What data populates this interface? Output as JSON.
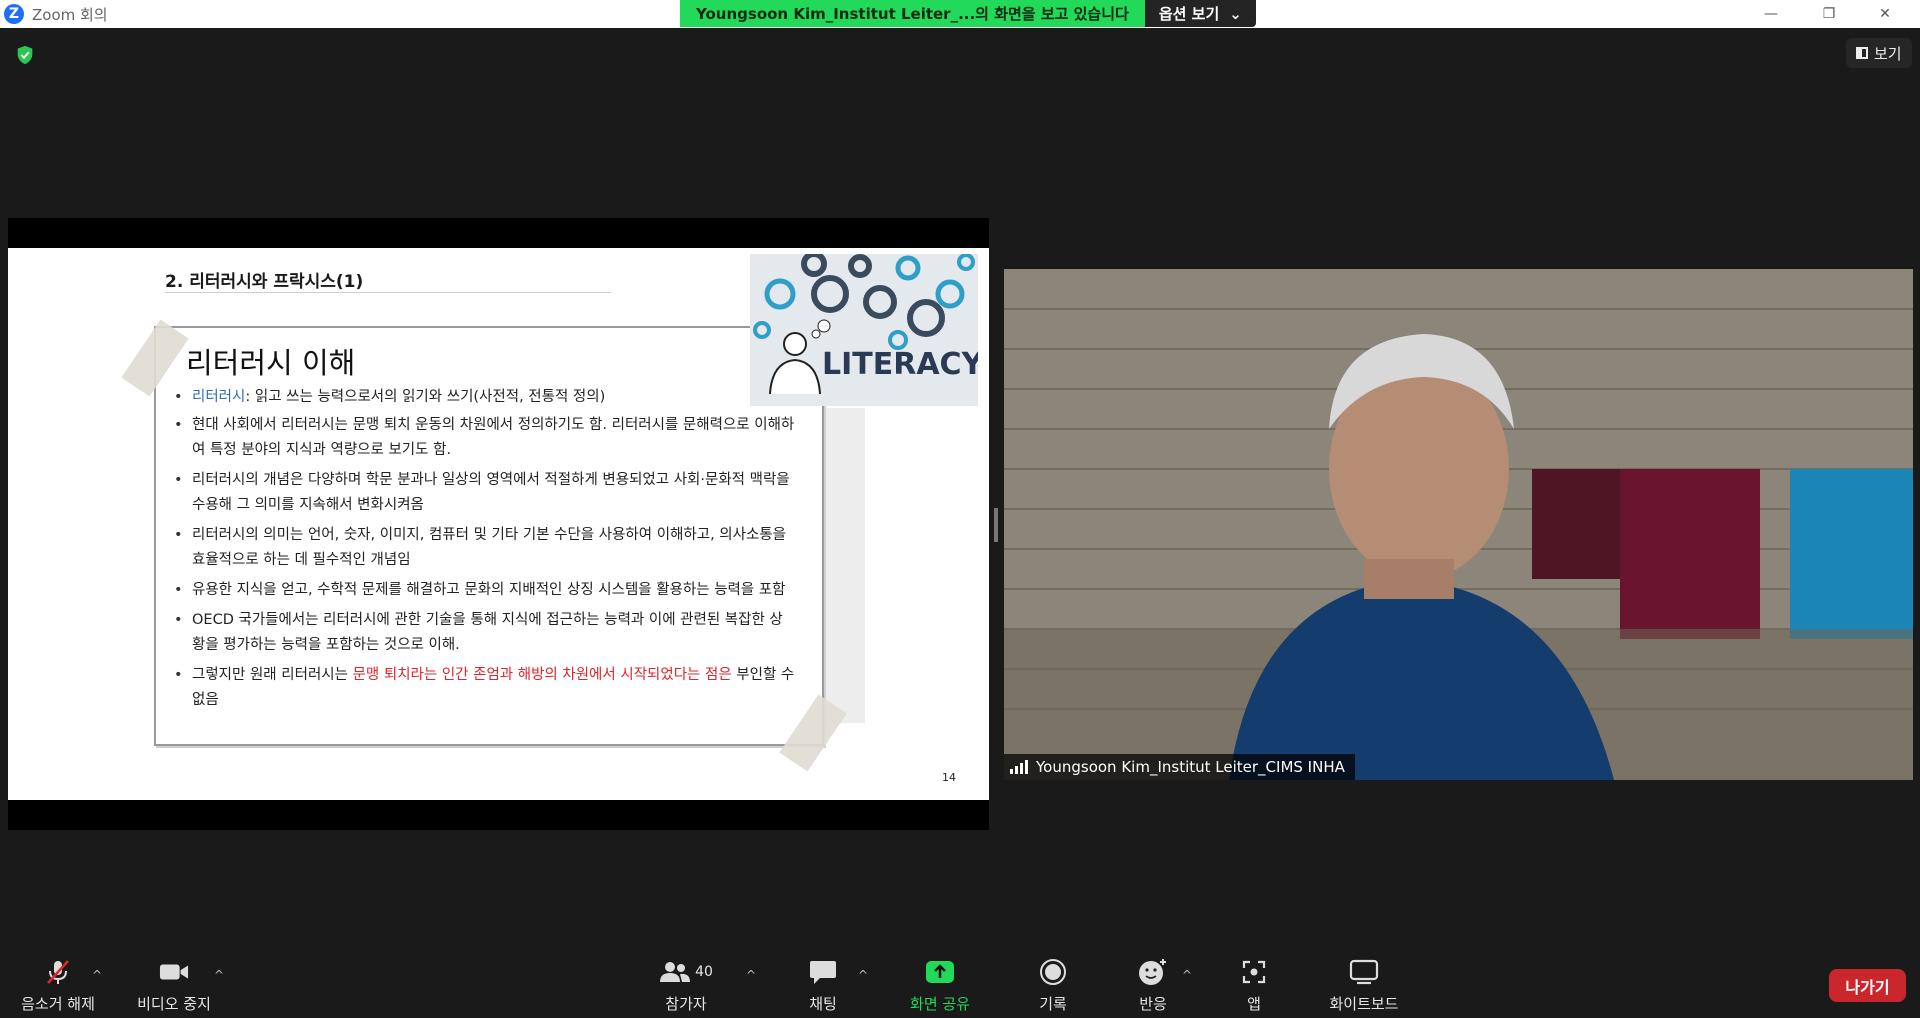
{
  "window": {
    "title": "Zoom 회의",
    "logo_letter": "Z"
  },
  "share_banner": {
    "message": "Youngsoon  Kim_Institut  Leiter_...의 화면을 보고 있습니다",
    "options_label": "옵션 보기"
  },
  "view_button": {
    "label": "보기"
  },
  "slide": {
    "section_title": "2. 리터러시와 프락시스(1)",
    "heading": "리터러시 이해",
    "bullet1_term": "리터러시",
    "bullet1_rest": ": 읽고 쓰는 능력으로서의 읽기와 쓰기(사전적, 전통적 정의)",
    "bullets": [
      "현대 사회에서 리터러시는 문맹 퇴치 운동의 차원에서 정의하기도 함. 리터러시를 문해력으로 이해하여 특정 분야의 지식과 역량으로 보기도 함.",
      "리터러시의 개념은 다양하며 학문 분과나 일상의 영역에서 적절하게 변용되었고 사회·문화적 맥락을 수용해 그 의미를 지속해서 변화시켜옴",
      "리터러시의 의미는 언어, 숫자, 이미지, 컴퓨터 및 기타 기본 수단을 사용하여 이해하고, 의사소통을 효율적으로 하는 데 필수적인 개념임",
      "유용한 지식을 얻고, 수학적 문제를 해결하고 문화의 지배적인 상징 시스템을 활용하는 능력을 포함",
      "OECD 국가들에서는 리터러시에 관한 기술을 통해 지식에 접근하는 능력과 이에 관련된 복잡한 상황을 평가하는 능력을 포함하는 것으로 이해."
    ],
    "last_bullet_start": "그렇지만 원래 리터러시는 ",
    "last_bullet_red": "문맹 퇴치라는 인간 존엄과 해방의 차원에서 시작되었다는 점은",
    "last_bullet_end": " 부인할 수 없음",
    "image_word": "LITERACY",
    "page_number": "14"
  },
  "participant": {
    "name": "Youngsoon Kim_Institut Leiter_CIMS INHA"
  },
  "toolbar": {
    "unmute": "음소거 해제",
    "stop_video": "비디오 중지",
    "participants": "참가자",
    "participant_count": "40",
    "chat": "채팅",
    "share_screen": "화면 공유",
    "record": "기록",
    "reactions": "반응",
    "apps": "앱",
    "whiteboard": "화이트보드",
    "leave": "나가기"
  },
  "colors": {
    "share_green": "#23d959",
    "leave_red": "#c9272c",
    "slide_red": "#e0252b",
    "term_blue": "#2e6fba"
  }
}
